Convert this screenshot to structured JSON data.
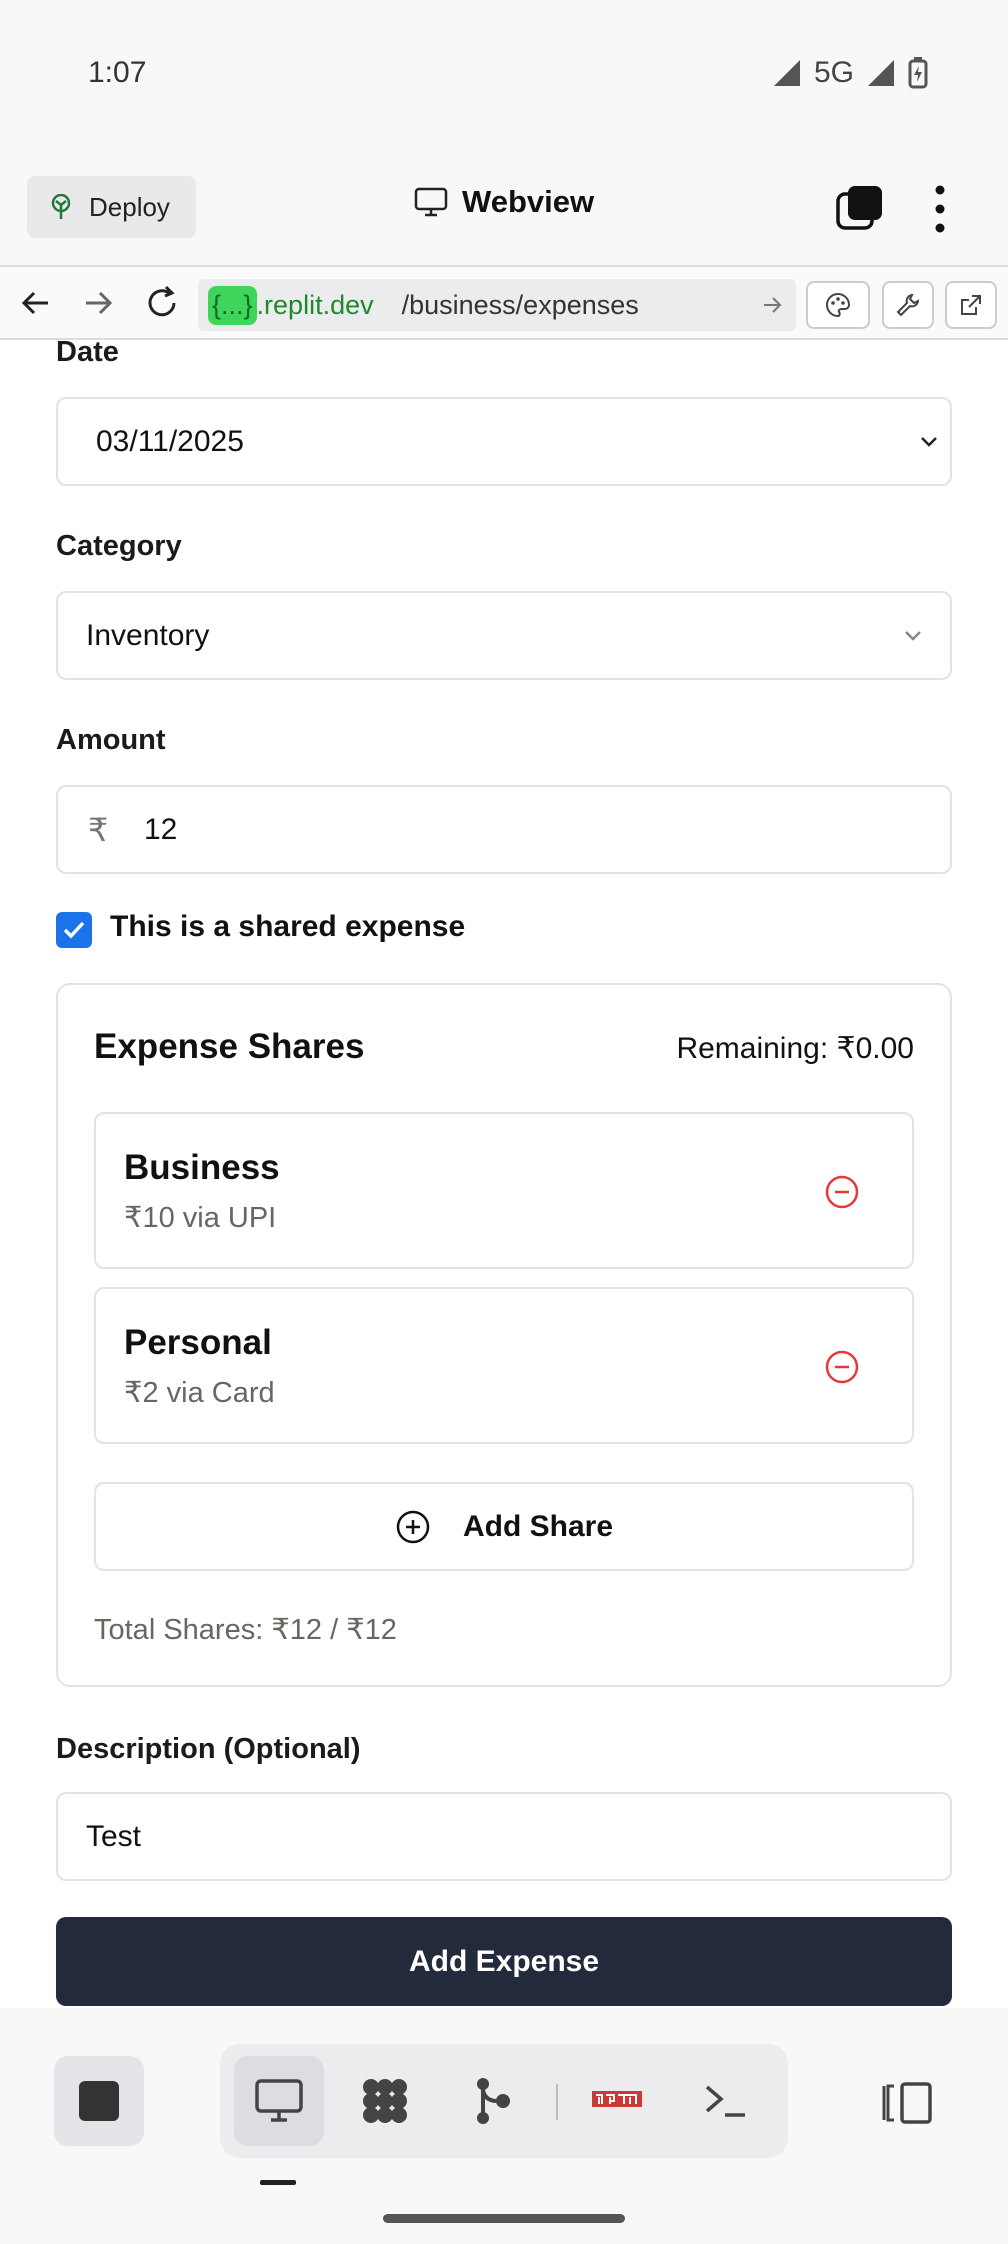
{
  "status_bar": {
    "time": "1:07",
    "network": "5G"
  },
  "header": {
    "deploy_label": "Deploy",
    "title": "Webview"
  },
  "url_bar": {
    "host_highlight": "{...}",
    "host_suffix": ".replit.dev",
    "path": "/business/expenses"
  },
  "form": {
    "date_label": "Date",
    "date_value": "03/11/2025",
    "category_label": "Category",
    "category_value": "Inventory",
    "amount_label": "Amount",
    "currency_symbol": "₹",
    "amount_value": "12",
    "shared_label": "This is a shared expense",
    "shared_checked": true,
    "shares": {
      "title": "Expense Shares",
      "remaining": "Remaining: ₹0.00",
      "items": [
        {
          "name": "Business",
          "detail": "₹10 via UPI"
        },
        {
          "name": "Personal",
          "detail": "₹2 via Card"
        }
      ],
      "add_label": "Add Share",
      "total": "Total Shares: ₹12 / ₹12"
    },
    "description_label": "Description (Optional)",
    "description_value": "Test",
    "submit_label": "Add Expense"
  },
  "colors": {
    "accent": "#1a73e8",
    "danger": "#e53935",
    "submit_bg": "#232a3b",
    "url_host": "#1f8a2d"
  },
  "bottom_toolbar": {
    "items": [
      "webview-icon",
      "workflows-icon",
      "git-icon",
      "npm-icon",
      "shell-icon"
    ]
  }
}
